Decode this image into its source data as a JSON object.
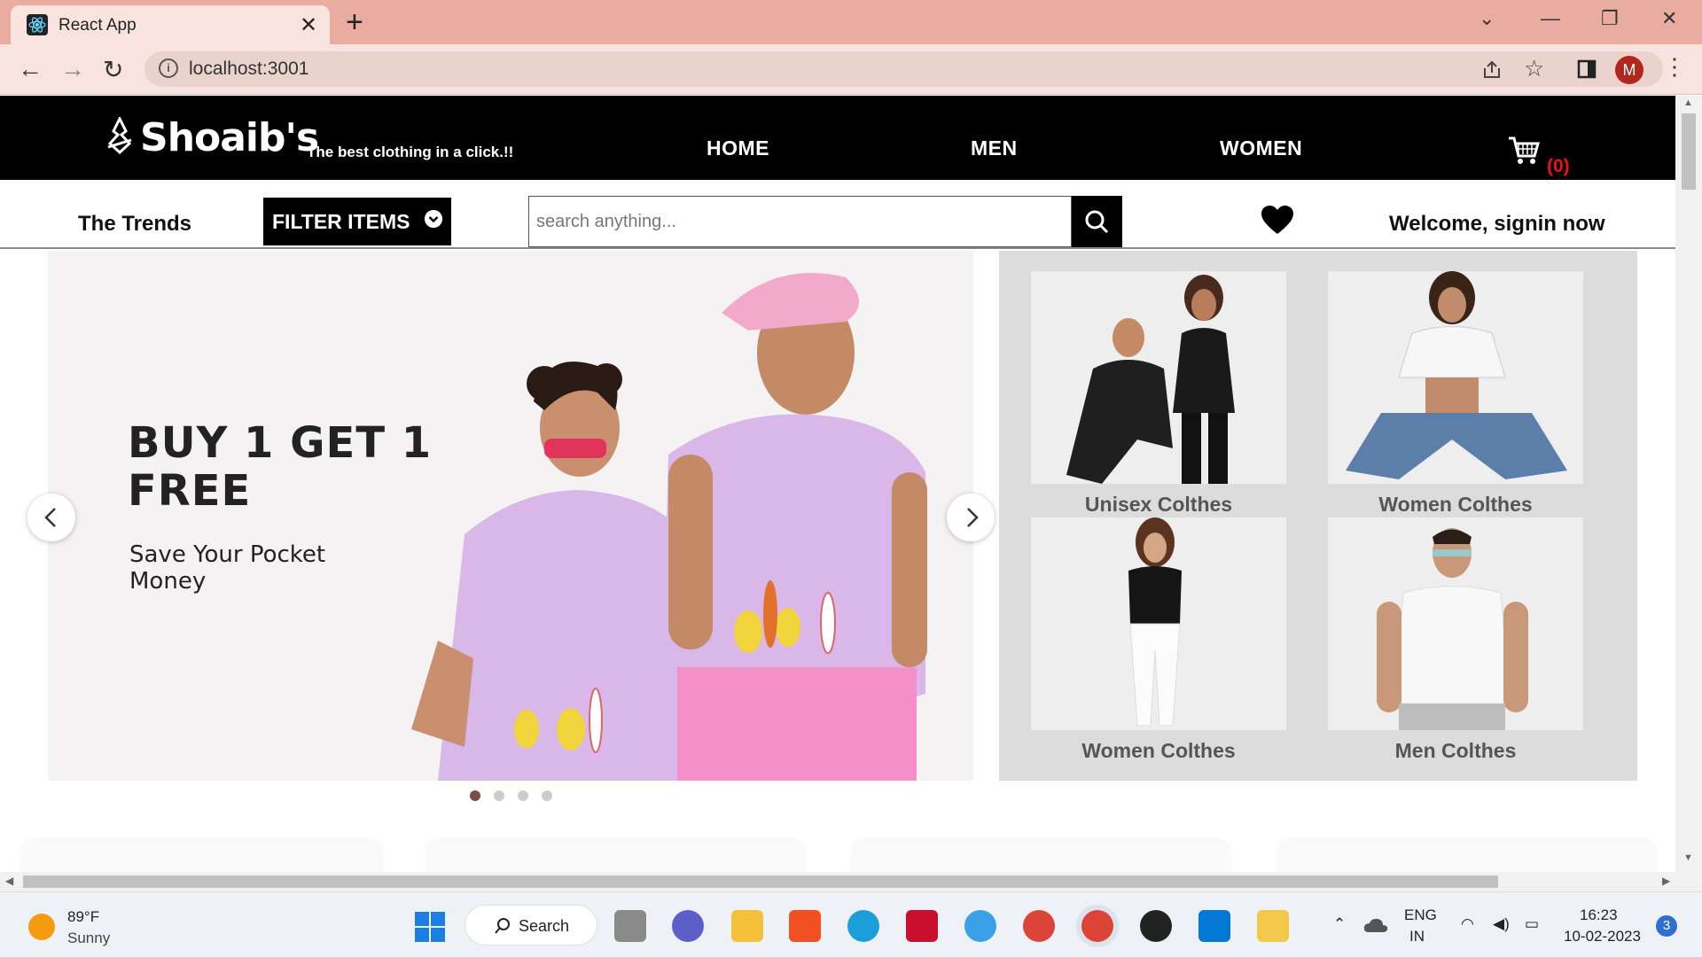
{
  "browser": {
    "tab_title": "React App",
    "url": "localhost:3001",
    "avatar_letter": "M"
  },
  "header": {
    "brand": "Shoaib's",
    "tagline": "The best clothing in a click.!!",
    "nav": [
      "HOME",
      "MEN",
      "WOMEN"
    ],
    "cart_count": "(0)"
  },
  "subbar": {
    "trends": "The Trends",
    "filter_label": "FILTER ITEMS",
    "search_placeholder": "search anything...",
    "signin": "Welcome, signin now"
  },
  "hero": {
    "headline_line1": "BUY 1 GET 1",
    "headline_line2": "FREE",
    "sub_line1": "Save Your Pocket",
    "sub_line2": "Money",
    "slide_count": 4,
    "active_slide": 1
  },
  "categories": [
    {
      "label": "Unisex Colthes"
    },
    {
      "label": "Women Colthes"
    },
    {
      "label": "Women Colthes"
    },
    {
      "label": "Men Colthes"
    }
  ],
  "taskbar": {
    "temp": "89°F",
    "condition": "Sunny",
    "search_label": "Search",
    "lang_top": "ENG",
    "lang_bottom": "IN",
    "time": "16:23",
    "date": "10-02-2023",
    "notification_count": "3"
  },
  "colors": {
    "tabbar": "#e8ada0",
    "header_bg": "#000000",
    "cart_count": "#ee1111",
    "hero_bg": "#f4f2f3",
    "tee_lilac": "#d9b7e8",
    "shorts_pink": "#f58fc9"
  }
}
